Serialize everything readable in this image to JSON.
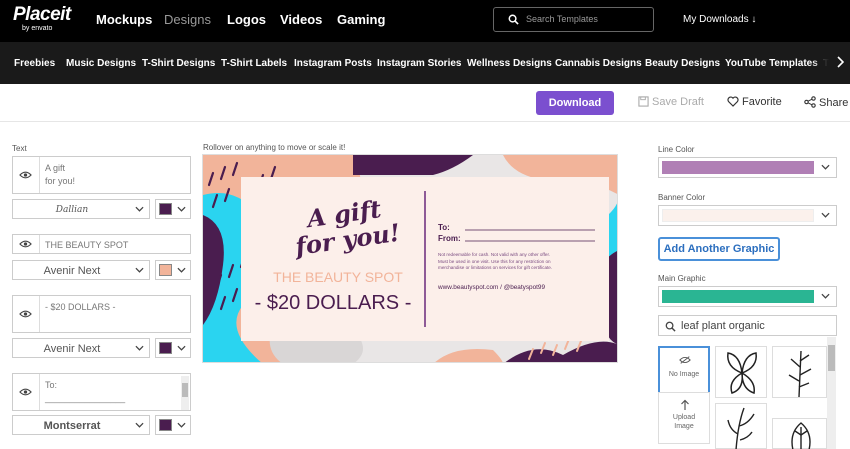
{
  "logo": {
    "main": "Placeit",
    "sub": "by envato"
  },
  "nav": {
    "items": [
      "Mockups",
      "Designs",
      "Logos",
      "Videos",
      "Gaming"
    ],
    "search_placeholder": "Search Templates",
    "my_downloads": "My Downloads ↓"
  },
  "categories": [
    "Freebies",
    "Music Designs",
    "T-Shirt Designs",
    "T-Shirt Labels",
    "Instagram Posts",
    "Instagram Stories",
    "Wellness Designs",
    "Cannabis Designs",
    "Beauty Designs",
    "YouTube Templates",
    "Tw"
  ],
  "actions": {
    "download": "Download",
    "save_draft": "Save Draft",
    "favorite": "Favorite",
    "share": "Share"
  },
  "left_panel": {
    "text_label": "Text",
    "fields": [
      {
        "line1": "A gift",
        "line2": "for you!",
        "font": "Dallian",
        "color": "#4a1d4f"
      },
      {
        "line1": "THE BEAUTY SPOT",
        "line2": "",
        "font": "Avenir Next",
        "color": "#f2b49a"
      },
      {
        "line1": "- $20 DOLLARS -",
        "line2": "",
        "font": "Avenir Next",
        "color": "#4a1d4f"
      },
      {
        "line1": "To:",
        "line2": "________________",
        "font": "Montserrat",
        "color": "#4a1d4f"
      }
    ]
  },
  "canvas": {
    "hint": "Rollover on anything to move or scale it!",
    "card": {
      "headline_1": "A gift",
      "headline_2": "for you!",
      "brand": "THE BEAUTY SPOT",
      "amount": "- $20 DOLLARS -",
      "to_label": "To:",
      "from_label": "From:",
      "fine_print_1": "Not redeemable for cash. Not valid with any other offer.",
      "fine_print_2": "Must be used in one visit. Use this for any restriction on",
      "fine_print_3": "merchandise or limitations on services for gift certificate.",
      "contact": "www.beautyspot.com / @beatyspot99"
    }
  },
  "right_panel": {
    "line_color_label": "Line Color",
    "line_color": "#b07fb5",
    "banner_color_label": "Banner Color",
    "banner_color": "#fbf1ec",
    "add_graphic": "Add Another Graphic",
    "main_graphic_label": "Main Graphic",
    "main_graphic_color": "#2ab593",
    "graphic_search": "leaf plant organic",
    "no_image": "No Image",
    "upload_image_1": "Upload",
    "upload_image_2": "Image"
  },
  "colors": {
    "accent_purple": "#7b4fcf",
    "nav_bg": "#000000",
    "catbar_bg": "#1a1a1a",
    "card_bg": "#fcefea",
    "plum": "#4a1d4f",
    "peach": "#f2b49a",
    "cyan": "#2ad4f0",
    "link_blue": "#2c6fbf"
  }
}
